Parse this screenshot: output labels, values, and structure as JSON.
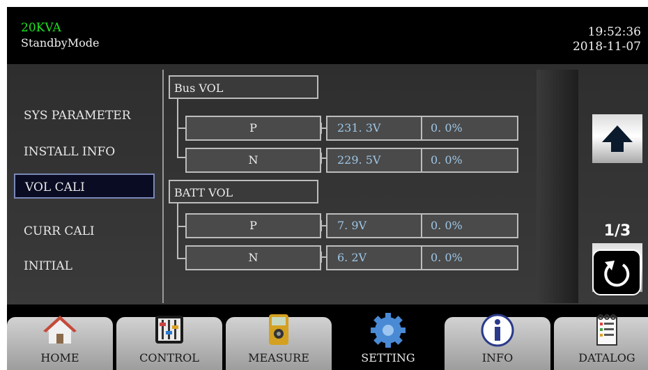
{
  "header": {
    "model": "20KVA",
    "mode": "StandbyMode",
    "time": "19:52:36",
    "date": "2018-11-07"
  },
  "menu": {
    "items": [
      {
        "label": "SYS PARAMETER",
        "active": false
      },
      {
        "label": "INSTALL INFO",
        "active": false
      },
      {
        "label": "VOL CALI",
        "active": true
      },
      {
        "label": "CURR CALI",
        "active": false
      },
      {
        "label": "INITIAL",
        "active": false
      }
    ]
  },
  "groups": [
    {
      "title": "Bus VOL",
      "rows": [
        {
          "name": "P",
          "value": "231. 3V",
          "percent": "0. 0%"
        },
        {
          "name": "N",
          "value": "229. 5V",
          "percent": "0. 0%"
        }
      ]
    },
    {
      "title": "BATT VOL",
      "rows": [
        {
          "name": "P",
          "value": "7. 9V",
          "percent": "0. 0%"
        },
        {
          "name": "N",
          "value": "6. 2V",
          "percent": "0. 0%"
        }
      ]
    }
  ],
  "pager": {
    "text": "1/3"
  },
  "tabs": [
    {
      "label": "HOME",
      "icon": "home-icon",
      "active": false
    },
    {
      "label": "CONTROL",
      "icon": "control-icon",
      "active": false
    },
    {
      "label": "MEASURE",
      "icon": "multimeter-icon",
      "active": false
    },
    {
      "label": "SETTING",
      "icon": "gear-icon",
      "active": true
    },
    {
      "label": "INFO",
      "icon": "info-icon",
      "active": false
    },
    {
      "label": "DATALOG",
      "icon": "datalog-icon",
      "active": false
    }
  ],
  "colors": {
    "model_text": "#22e022",
    "value_text": "#9ec6e6",
    "active_menu_border": "#7a88b8",
    "active_menu_bg": "#0a0c24"
  }
}
